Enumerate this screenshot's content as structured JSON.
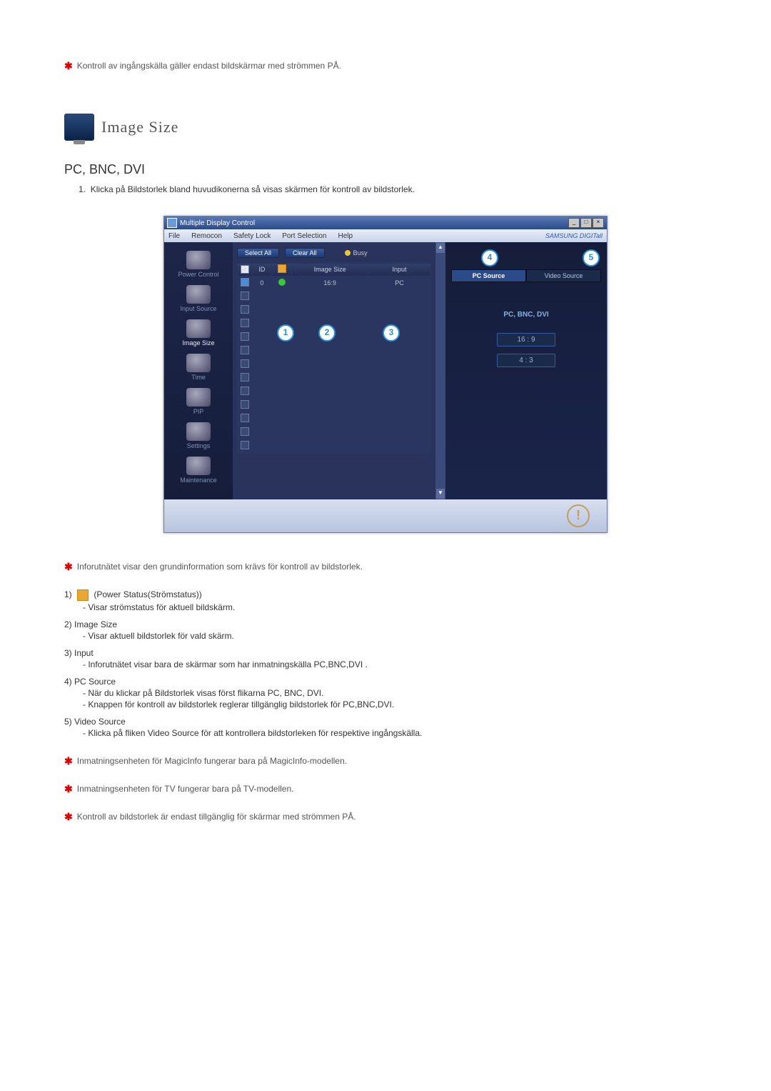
{
  "top_note": "Kontroll av ingångskälla gäller endast bildskärmar med strömmen PÅ.",
  "section_title": "Image Size",
  "sub_title": "PC, BNC, DVI",
  "instruction_1": "Klicka på Bildstorlek bland huvudikonerna så visas skärmen för kontroll av bildstorlek.",
  "app": {
    "title": "Multiple Display Control",
    "menu": {
      "file": "File",
      "remocon": "Remocon",
      "safety": "Safety Lock",
      "port": "Port Selection",
      "help": "Help"
    },
    "brand": "SAMSUNG DIGITall",
    "sidebar": {
      "power": "Power Control",
      "input": "Input Source",
      "image": "Image Size",
      "time": "Time",
      "pip": "PIP",
      "settings": "Settings",
      "maintenance": "Maintenance"
    },
    "toolbar": {
      "select_all": "Select All",
      "clear_all": "Clear All",
      "busy": "Busy"
    },
    "grid": {
      "headers": {
        "id": "ID",
        "image_size": "Image Size",
        "input": "Input"
      },
      "row": {
        "id": "0",
        "image_size": "16:9",
        "input": "PC"
      }
    },
    "right": {
      "tab_pc": "PC Source",
      "tab_video": "Video Source",
      "label": "PC, BNC, DVI",
      "ratio1": "16 : 9",
      "ratio2": "4 : 3"
    },
    "callouts": {
      "c1": "1",
      "c2": "2",
      "c3": "3",
      "c4": "4",
      "c5": "5"
    }
  },
  "notes": {
    "info_grid": "Inforutnätet visar den grundinformation som krävs för kontroll av bildstorlek.",
    "item1_label": "1)",
    "item1_title": "(Power Status(Strömstatus))",
    "item1_line": "- Visar strömstatus för aktuell bildskärm.",
    "item2_label": "2)  Image Size",
    "item2_line": "- Visar aktuell bildstorlek för vald skärm.",
    "item3_label": "3)  Input",
    "item3_line": "- Inforutnätet visar bara de skärmar som har inmatningskälla PC,BNC,DVI .",
    "item4_label": "4)  PC Source",
    "item4_line1": "- När du klickar på Bildstorlek visas först flikarna PC, BNC, DVI.",
    "item4_line2": "- Knappen för kontroll av bildstorlek reglerar tillgänglig bildstorlek för PC,BNC,DVI.",
    "item5_label": "5)  Video Source",
    "item5_line": "- Klicka på fliken Video Source för att kontrollera bildstorleken för respektive ingångskälla.",
    "star1": "Inmatningsenheten för MagicInfo fungerar bara på MagicInfo-modellen.",
    "star2": "Inmatningsenheten för TV fungerar bara på TV-modellen.",
    "star3": "Kontroll av bildstorlek är endast tillgänglig för skärmar med strömmen PÅ."
  }
}
